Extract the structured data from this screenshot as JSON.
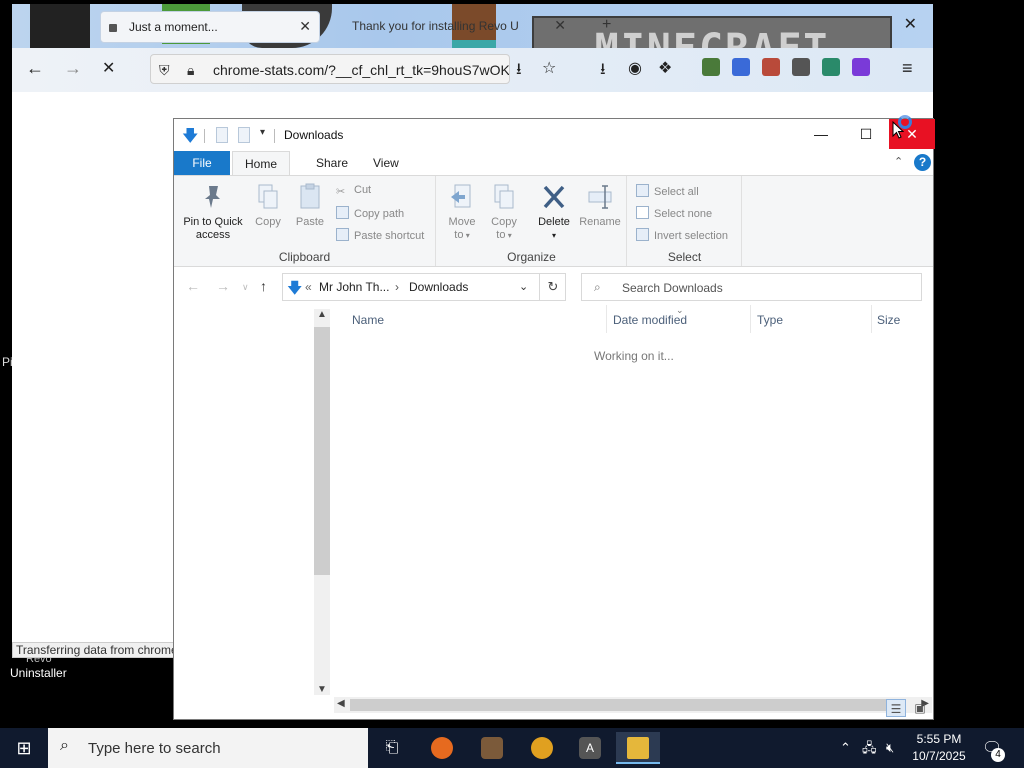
{
  "browser": {
    "tabs": [
      {
        "title": "Just a moment...",
        "close": "✕"
      },
      {
        "title": "Thank you for installing Revo U",
        "close": "✕"
      }
    ],
    "new_tab": "+",
    "close_window": "✕",
    "logo_text": "MINECRAFT",
    "url": "chrome-stats.com/?__cf_chl_rt_tk=9houS7wOK",
    "status_text": "Transferring data from chrome"
  },
  "desktop": {
    "side_label": "Pi",
    "icon_label_line1": "Revo",
    "icon_label_line2": "Uninstaller"
  },
  "explorer": {
    "title": "Downloads",
    "ribbon_tabs": [
      "File",
      "Home",
      "Share",
      "View"
    ],
    "clipboard": {
      "label": "Clipboard",
      "pin_line1": "Pin to Quick",
      "pin_line2": "access",
      "copy": "Copy",
      "paste": "Paste",
      "cut": "Cut",
      "copy_path": "Copy path",
      "paste_shortcut": "Paste shortcut"
    },
    "organize": {
      "label": "Organize",
      "move_to_1": "Move",
      "move_to_2": "to",
      "copy_to_1": "Copy",
      "copy_to_2": "to",
      "delete": "Delete",
      "rename": "Rename"
    },
    "select": {
      "label": "Select",
      "select_all": "Select all",
      "select_none": "Select none",
      "invert": "Invert selection"
    },
    "address": {
      "prefix": "«",
      "crumb1": "Mr John Th...",
      "separator": "›",
      "crumb2": "Downloads"
    },
    "search_placeholder": "Search Downloads",
    "columns": [
      "Name",
      "Date modified",
      "Type",
      "Size"
    ],
    "status_message": "Working on it..."
  },
  "taskbar": {
    "search_placeholder": "Type here to search",
    "time": "5:55 PM",
    "date": "10/7/2025",
    "notification_count": "4"
  }
}
